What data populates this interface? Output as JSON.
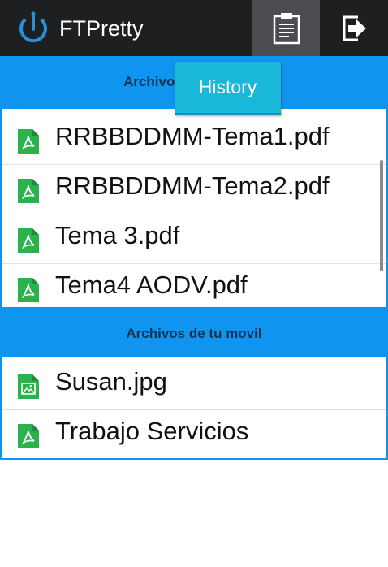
{
  "app": {
    "title": "FTPretty"
  },
  "actionbar": {
    "history_icon": "clipboard-icon",
    "logout_icon": "exit-icon"
  },
  "popup": {
    "label": "History"
  },
  "server_section": {
    "header": "Archivos del servidor",
    "files": [
      {
        "name": "RRBBDDMM-Tema1.pdf",
        "icon": "pdf-file-icon"
      },
      {
        "name": "RRBBDDMM-Tema2.pdf",
        "icon": "pdf-file-icon"
      },
      {
        "name": "Tema 3.pdf",
        "icon": "pdf-file-icon"
      },
      {
        "name": "Tema4 AODV.pdf",
        "icon": "pdf-file-icon"
      }
    ]
  },
  "mobile_section": {
    "header": "Archivos de tu movil",
    "files": [
      {
        "name": "Susan.jpg",
        "icon": "image-file-icon"
      },
      {
        "name": "Trabajo Servicios",
        "icon": "pdf-file-icon"
      }
    ]
  },
  "colors": {
    "accent": "#0f95f0",
    "actionbar": "#1e1f21",
    "popup": "#1ab8d8",
    "file_icon": "#2bb24c"
  }
}
